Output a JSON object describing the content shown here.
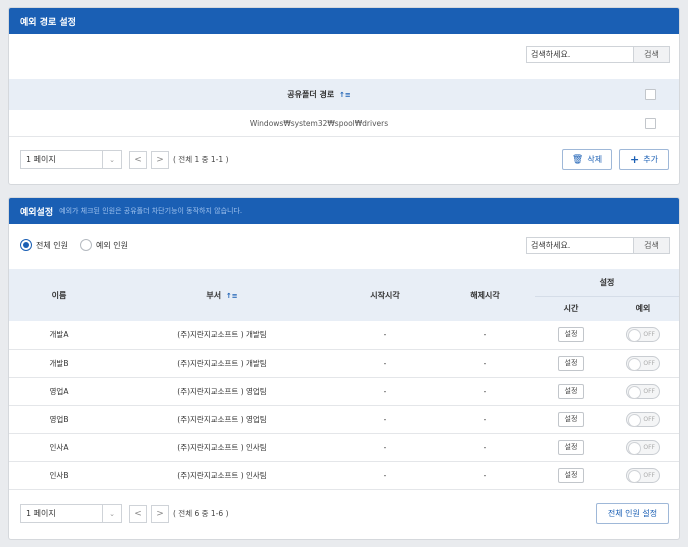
{
  "path_panel": {
    "title": "예외 경로 설정",
    "search_placeholder": "검색하세요.",
    "search_button": "검색",
    "column_header": "공유폴더 경로",
    "sort_icon": "↑≡",
    "rows": [
      {
        "path": "Windows₩system32₩spool₩drivers"
      }
    ],
    "pager": {
      "page_select": "1 페이지",
      "prev": "<",
      "next": ">",
      "count": "( 전체 1 중 1-1 )"
    },
    "delete_button": "삭제",
    "add_button": "추가"
  },
  "exception_panel": {
    "title": "예외설정",
    "description": "예외가 체크된 인원은 공유폴더 차단기능이 동작하지 않습니다.",
    "radio_all": "전체 인원",
    "radio_except": "예외 인원",
    "radio_selected": "전체 인원",
    "search_placeholder": "검색하세요.",
    "search_button": "검색",
    "columns": {
      "name": "이름",
      "dept": "부서",
      "sort_icon": "↑≡",
      "start": "시작시각",
      "end": "해제시각",
      "settings": "설정",
      "time": "시간",
      "exception": "예외"
    },
    "rows": [
      {
        "name": "개발A",
        "dept": "(주)지란지교소프트 ) 개발팀",
        "start": "-",
        "end": "-",
        "time_btn": "설정",
        "toggle": "OFF"
      },
      {
        "name": "개발B",
        "dept": "(주)지란지교소프트 ) 개발팀",
        "start": "-",
        "end": "-",
        "time_btn": "설정",
        "toggle": "OFF"
      },
      {
        "name": "영업A",
        "dept": "(주)지란지교소프트 ) 영업팀",
        "start": "-",
        "end": "-",
        "time_btn": "설정",
        "toggle": "OFF"
      },
      {
        "name": "영업B",
        "dept": "(주)지란지교소프트 ) 영업팀",
        "start": "-",
        "end": "-",
        "time_btn": "설정",
        "toggle": "OFF"
      },
      {
        "name": "인사A",
        "dept": "(주)지란지교소프트 ) 인사팀",
        "start": "-",
        "end": "-",
        "time_btn": "설정",
        "toggle": "OFF"
      },
      {
        "name": "인사B",
        "dept": "(주)지란지교소프트 ) 인사팀",
        "start": "-",
        "end": "-",
        "time_btn": "설정",
        "toggle": "OFF"
      }
    ],
    "pager": {
      "page_select": "1 페이지",
      "prev": "<",
      "next": ">",
      "count": "( 전체 6 중 1-6 )"
    },
    "all_setting_button": "전체 인원 설정"
  },
  "colors": {
    "header_blue": "#1a5fb4",
    "table_header": "#e8eef6"
  }
}
